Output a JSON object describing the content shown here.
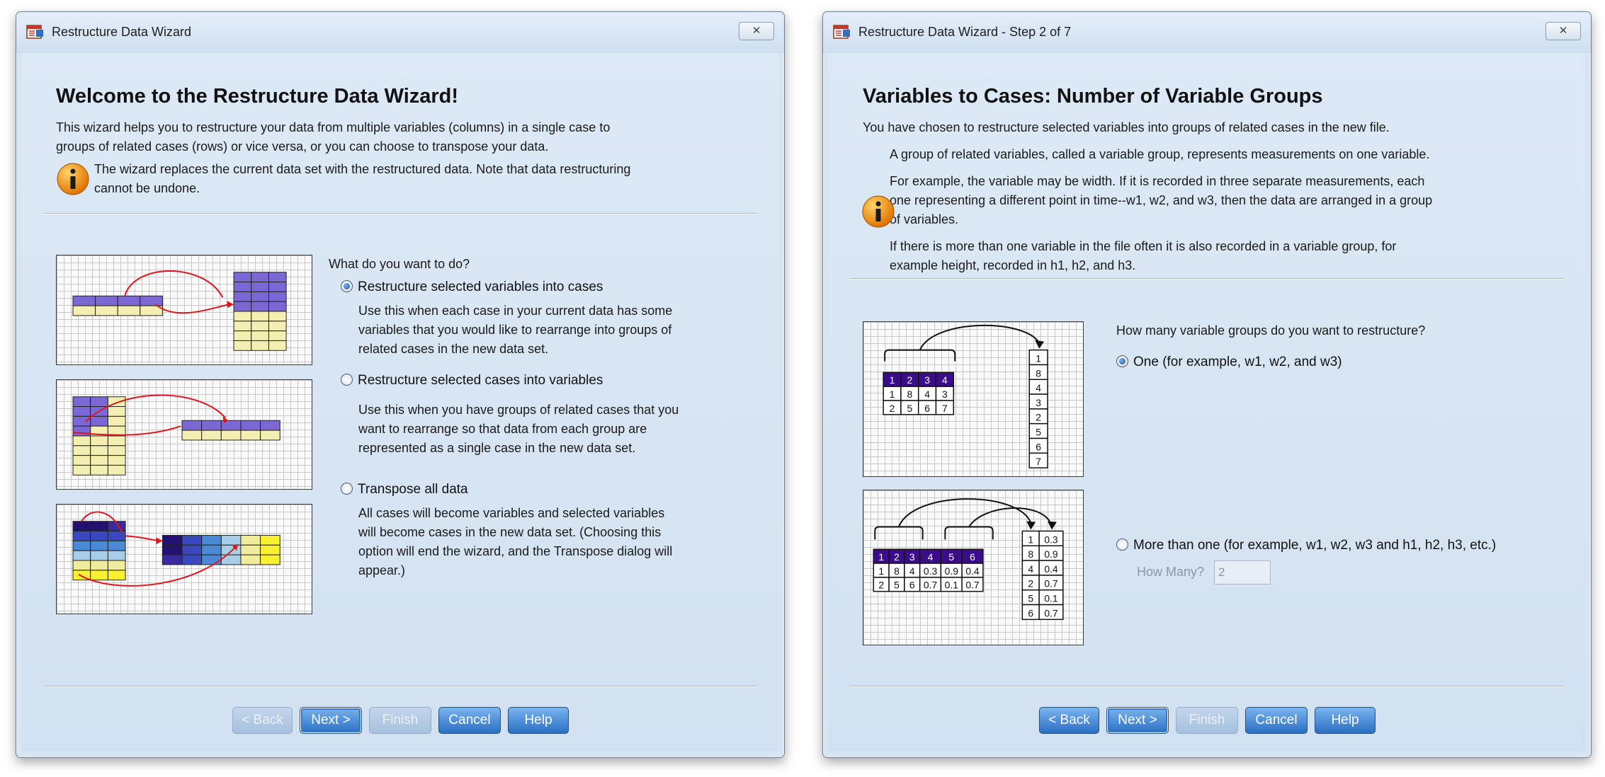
{
  "window1": {
    "title": "Restructure Data Wizard",
    "close_glyph": "✕",
    "heading": "Welcome to the Restructure Data Wizard!",
    "intro_line1": "This wizard helps you to restructure your data from multiple variables (columns) in a single case to",
    "intro_line2": "groups of related cases (rows) or vice versa, or you can choose to transpose your data.",
    "warning_line1": "The wizard replaces the current data set with the restructured data.  Note that data restructuring",
    "warning_line2": "cannot be undone.",
    "question": "What do you want to do?",
    "options": [
      {
        "label": "Restructure selected variables into cases",
        "selected": true,
        "desc": [
          "Use this when each case in your current data has some",
          "variables that you would like to rearrange into groups of",
          "related cases in the new data set."
        ]
      },
      {
        "label": "Restructure selected cases into variables",
        "selected": false,
        "desc": [
          "Use this when you have groups of related cases that you",
          "want to rearrange so that data from each group are",
          "represented as a single case in the new data set."
        ]
      },
      {
        "label": "Transpose all data",
        "selected": false,
        "desc": [
          "All cases will become variables and selected variables",
          "will become cases in the new data set. (Choosing this",
          "option will end the wizard, and the Transpose dialog will",
          "appear.)"
        ]
      }
    ],
    "buttons": {
      "back": "< Back",
      "next": "Next >",
      "finish": "Finish",
      "cancel": "Cancel",
      "help": "Help"
    }
  },
  "window2": {
    "title": "Restructure Data Wizard - Step 2 of 7",
    "close_glyph": "✕",
    "heading": "Variables to Cases: Number of Variable Groups",
    "intro": "You have chosen to restructure selected variables into groups of related cases in the new file.",
    "note1": "A group of related variables, called a variable group, represents measurements on one variable.",
    "note2_line1": "For example, the variable may be width.  If it is recorded in three separate measurements, each",
    "note2_line2": "one representing a different point in time--w1, w2, and w3, then the data are arranged in a group",
    "note2_line3": "of variables.",
    "note3_line1": "If there is more than one variable in the file often it is also recorded in a variable group, for",
    "note3_line2": "example height, recorded in h1, h2, and h3.",
    "question": "How many variable groups do you want to restructure?",
    "option_one": "One (for example, w1, w2, and w3)",
    "option_more": "More than one (for example, w1, w2, w3 and h1, h2, h3, etc.)",
    "how_many_label": "How Many?",
    "how_many_value": "2",
    "buttons": {
      "back": "< Back",
      "next": "Next >",
      "finish": "Finish",
      "cancel": "Cancel",
      "help": "Help"
    }
  },
  "illustration_one": {
    "header": [
      "1",
      "2",
      "3",
      "4"
    ],
    "rows": [
      [
        "1",
        "8",
        "4",
        "3"
      ],
      [
        "2",
        "5",
        "6",
        "7"
      ]
    ],
    "column": [
      "1",
      "8",
      "4",
      "3",
      "2",
      "5",
      "6",
      "7"
    ]
  },
  "illustration_more": {
    "header": [
      "1",
      "2",
      "3",
      "4",
      "5",
      "6"
    ],
    "rows": [
      [
        "1",
        "8",
        "4",
        "0.3",
        "0.9",
        "0.4"
      ],
      [
        "2",
        "5",
        "6",
        "0.7",
        "0.1",
        "0.7"
      ]
    ],
    "col_a": [
      "1",
      "8",
      "4",
      "2",
      "5",
      "6"
    ],
    "col_b": [
      "0.3",
      "0.9",
      "0.4",
      "0.7",
      "0.1",
      "0.7"
    ]
  },
  "colors": {
    "accent": "#2a6fc3",
    "client_bg": "#d7e4f2",
    "header_purple": "#3a0c8a",
    "arrow_red": "#e0141e"
  }
}
